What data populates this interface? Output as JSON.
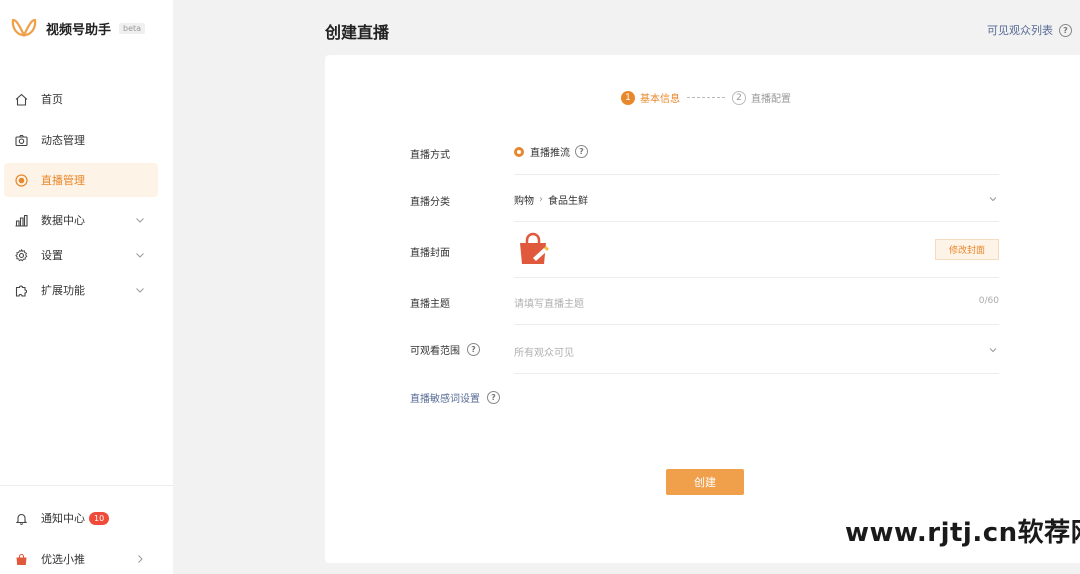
{
  "app": {
    "name": "视频号助手",
    "beta": "beta"
  },
  "colors": {
    "accent": "#e8872b",
    "link": "#576b95",
    "badge": "#f04b3a"
  },
  "sidebar": {
    "items": [
      {
        "label": "首页",
        "icon": "home-icon"
      },
      {
        "label": "动态管理",
        "icon": "camera-icon"
      },
      {
        "label": "直播管理",
        "icon": "live-icon",
        "active": true
      },
      {
        "label": "数据中心",
        "icon": "chart-icon"
      },
      {
        "label": "设置",
        "icon": "gear-icon"
      },
      {
        "label": "扩展功能",
        "icon": "puzzle-icon"
      }
    ],
    "bottom": [
      {
        "label": "通知中心",
        "badge": "10",
        "icon": "bell-icon"
      },
      {
        "label": "优选小推",
        "icon": "shopping-bag-icon"
      }
    ]
  },
  "header": {
    "title": "创建直播",
    "audience_link": "可见观众列表"
  },
  "steps": [
    {
      "num": "1",
      "label": "基本信息"
    },
    {
      "num": "2",
      "label": "直播配置"
    }
  ],
  "form": {
    "mode": {
      "label": "直播方式",
      "value": "直播推流"
    },
    "category": {
      "label": "直播分类",
      "level1": "购物",
      "level2": "食品生鲜"
    },
    "cover": {
      "label": "直播封面",
      "button": "修改封面"
    },
    "topic": {
      "label": "直播主题",
      "placeholder": "请填写直播主题",
      "counter": "0/60"
    },
    "scope": {
      "label": "可观看范围",
      "value": "所有观众可见"
    },
    "sensitive": {
      "label": "直播敏感词设置"
    },
    "submit": "创建"
  },
  "watermark": "www.rjtj.cn软荐网"
}
